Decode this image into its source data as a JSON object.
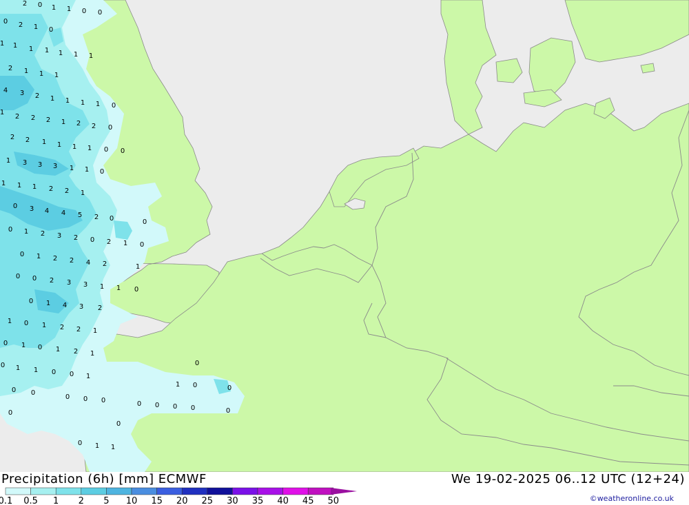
{
  "header": {
    "title": "Precipitation (6h) [mm] ECMWF",
    "valid_time": "We 19-02-2025 06..12 UTC (12+24)"
  },
  "credit": "©weatheronline.co.uk",
  "colors": {
    "sea": "#ececec",
    "land": "#ccf8a8",
    "border": "#8a8a8a"
  },
  "legend": {
    "labels": [
      "0.1",
      "0.5",
      "1",
      "2",
      "5",
      "10",
      "15",
      "20",
      "25",
      "30",
      "35",
      "40",
      "45",
      "50"
    ],
    "colors": [
      "#d2f9fa",
      "#a6f0f0",
      "#7ee2ea",
      "#5ccde2",
      "#4eb4e0",
      "#4a8ee0",
      "#3a5ee0",
      "#2030c0",
      "#10109a",
      "#7a10e8",
      "#a810e8",
      "#e010e8",
      "#c010c0",
      "#9a10a0"
    ]
  },
  "precip_labels": [
    {
      "t": "2"
    },
    {
      "t": "0"
    },
    {
      "t": "1"
    },
    {
      "t": "1"
    },
    {
      "t": "0"
    },
    {
      "t": "0"
    },
    {
      "t": "0"
    },
    {
      "t": "2"
    },
    {
      "t": "1"
    },
    {
      "t": "0"
    },
    {
      "t": "1"
    },
    {
      "t": "1"
    },
    {
      "t": "1"
    },
    {
      "t": "1"
    },
    {
      "t": "1"
    },
    {
      "t": "1"
    },
    {
      "t": "1"
    },
    {
      "t": "2"
    },
    {
      "t": "1"
    },
    {
      "t": "1"
    },
    {
      "t": "1"
    },
    {
      "t": "4"
    },
    {
      "t": "3"
    },
    {
      "t": "2"
    },
    {
      "t": "1"
    },
    {
      "t": "1"
    },
    {
      "t": "1"
    },
    {
      "t": "1"
    },
    {
      "t": "0"
    },
    {
      "t": "1"
    },
    {
      "t": "2"
    },
    {
      "t": "2"
    },
    {
      "t": "2"
    },
    {
      "t": "1"
    },
    {
      "t": "2"
    },
    {
      "t": "2"
    },
    {
      "t": "0"
    },
    {
      "t": "2"
    },
    {
      "t": "2"
    },
    {
      "t": "1"
    },
    {
      "t": "1"
    },
    {
      "t": "1"
    },
    {
      "t": "1"
    },
    {
      "t": "0"
    },
    {
      "t": "0"
    },
    {
      "t": "1"
    },
    {
      "t": "3"
    },
    {
      "t": "3"
    },
    {
      "t": "3"
    },
    {
      "t": "1"
    },
    {
      "t": "1"
    },
    {
      "t": "0"
    },
    {
      "t": "1"
    },
    {
      "t": "1"
    },
    {
      "t": "1"
    },
    {
      "t": "2"
    },
    {
      "t": "2"
    },
    {
      "t": "1"
    },
    {
      "t": "0"
    },
    {
      "t": "3"
    },
    {
      "t": "4"
    },
    {
      "t": "4"
    },
    {
      "t": "5"
    },
    {
      "t": "2"
    },
    {
      "t": "0"
    },
    {
      "t": "0"
    },
    {
      "t": "0"
    },
    {
      "t": "1"
    },
    {
      "t": "2"
    },
    {
      "t": "3"
    },
    {
      "t": "2"
    },
    {
      "t": "0"
    },
    {
      "t": "2"
    },
    {
      "t": "1"
    },
    {
      "t": "0"
    },
    {
      "t": "0"
    },
    {
      "t": "1"
    },
    {
      "t": "2"
    },
    {
      "t": "2"
    },
    {
      "t": "4"
    },
    {
      "t": "2"
    },
    {
      "t": "1"
    },
    {
      "t": "0"
    },
    {
      "t": "0"
    },
    {
      "t": "2"
    },
    {
      "t": "3"
    },
    {
      "t": "3"
    },
    {
      "t": "1"
    },
    {
      "t": "1"
    },
    {
      "t": "0"
    },
    {
      "t": "0"
    },
    {
      "t": "1"
    },
    {
      "t": "4"
    },
    {
      "t": "3"
    },
    {
      "t": "2"
    },
    {
      "t": "1"
    },
    {
      "t": "0"
    },
    {
      "t": "1"
    },
    {
      "t": "2"
    },
    {
      "t": "2"
    },
    {
      "t": "1"
    },
    {
      "t": "0"
    },
    {
      "t": "1"
    },
    {
      "t": "0"
    },
    {
      "t": "1"
    },
    {
      "t": "2"
    },
    {
      "t": "1"
    },
    {
      "t": "0"
    },
    {
      "t": "1"
    },
    {
      "t": "1"
    },
    {
      "t": "0"
    },
    {
      "t": "0"
    },
    {
      "t": "1"
    },
    {
      "t": "0"
    },
    {
      "t": "0"
    },
    {
      "t": "0"
    },
    {
      "t": "0"
    },
    {
      "t": "0"
    },
    {
      "t": "0"
    },
    {
      "t": "0"
    },
    {
      "t": "0"
    },
    {
      "t": "0"
    },
    {
      "t": "0"
    },
    {
      "t": "0"
    },
    {
      "t": "1"
    },
    {
      "t": "0"
    },
    {
      "t": "0"
    },
    {
      "t": "0"
    },
    {
      "t": "0"
    },
    {
      "t": "0"
    },
    {
      "t": "1"
    },
    {
      "t": "1"
    },
    {
      "t": "0"
    }
  ]
}
